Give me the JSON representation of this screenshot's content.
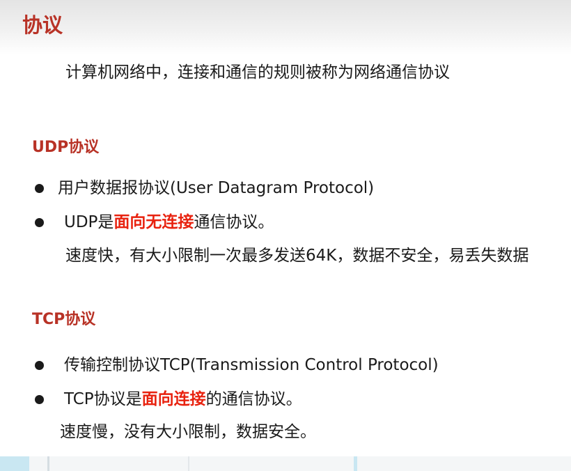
{
  "header": {
    "title": "协议"
  },
  "intro": "计算机网络中，连接和通信的规则被称为网络通信协议",
  "udp": {
    "title": "UDP协议",
    "bullet1": "用户数据报协议(User Datagram Protocol)",
    "bullet2_prefix": "UDP是",
    "bullet2_highlight": "面向无连接",
    "bullet2_suffix": "通信协议。",
    "detail": "速度快，有大小限制一次最多发送64K，数据不安全，易丢失数据"
  },
  "tcp": {
    "title": "TCP协议",
    "bullet1": "传输控制协议TCP(Transmission Control Protocol)",
    "bullet2_prefix": "TCP协议是",
    "bullet2_highlight": "面向连接",
    "bullet2_suffix": "的通信协议。",
    "detail": "速度慢，没有大小限制，数据安全。"
  },
  "colors": {
    "heading": "#b83226",
    "highlight": "#e8220f",
    "text": "#1a1a1a"
  }
}
